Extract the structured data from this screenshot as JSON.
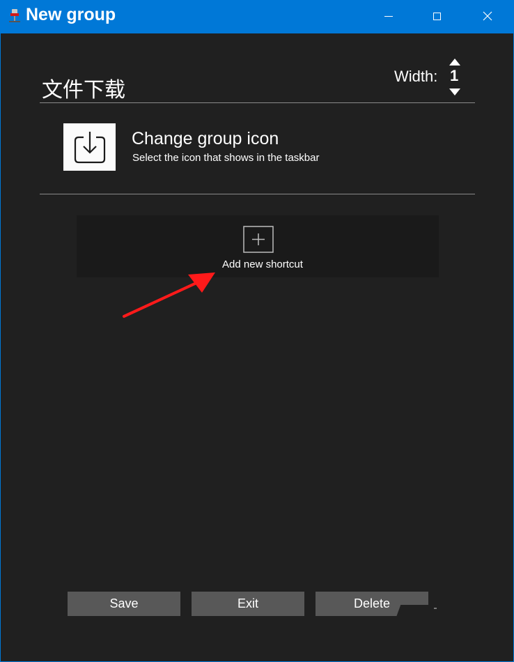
{
  "window": {
    "title": "New group",
    "app_icon": "pin-icon",
    "controls": [
      "minimize-icon",
      "maximize-icon",
      "close-icon"
    ]
  },
  "header": {
    "group_name": "文件下载",
    "width_label": "Width:",
    "width_value": "1"
  },
  "group_icon": {
    "icon": "download-tray-icon",
    "title": "Change group icon",
    "subtitle": "Select the icon that shows in the taskbar"
  },
  "shortcuts": {
    "add_icon": "plus-icon",
    "add_label": "Add new shortcut"
  },
  "annotation": {
    "arrow_color": "#ff1a1a"
  },
  "footer": {
    "save_label": "Save",
    "exit_label": "Exit",
    "delete_label": "Delete"
  },
  "colors": {
    "titlebar": "#0078d7",
    "background": "#202020",
    "panel": "#1a1a1a",
    "button": "#585858"
  }
}
